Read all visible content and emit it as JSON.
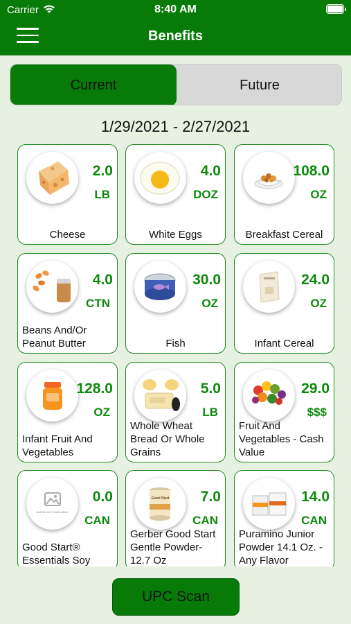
{
  "status_bar": {
    "carrier": "Carrier",
    "time": "8:40 AM"
  },
  "header": {
    "title": "Benefits"
  },
  "tabs": {
    "current": "Current",
    "future": "Future"
  },
  "date_range": "1/29/2021 - 2/27/2021",
  "benefits": [
    {
      "name": "Cheese",
      "qty": "2.0",
      "unit": "LB",
      "icon": "cheese-icon"
    },
    {
      "name": "White Eggs",
      "qty": "4.0",
      "unit": "DOZ",
      "icon": "egg-icon"
    },
    {
      "name": "Breakfast Cereal",
      "qty": "108.0",
      "unit": "OZ",
      "icon": "cereal-icon"
    },
    {
      "name": "Beans And/Or Peanut Butter",
      "qty": "4.0",
      "unit": "CTN",
      "icon": "beans-peanut-butter-icon"
    },
    {
      "name": "Fish",
      "qty": "30.0",
      "unit": "OZ",
      "icon": "fish-can-icon"
    },
    {
      "name": "Infant Cereal",
      "qty": "24.0",
      "unit": "OZ",
      "icon": "infant-cereal-icon"
    },
    {
      "name": "Infant Fruit And Vegetables",
      "qty": "128.0",
      "unit": "OZ",
      "icon": "baby-food-jar-icon"
    },
    {
      "name": "Whole Wheat Bread Or Whole Grains",
      "qty": "5.0",
      "unit": "LB",
      "icon": "bread-icon"
    },
    {
      "name": "Fruit And Vegetables - Cash Value",
      "qty": "29.0",
      "unit": "$$$",
      "icon": "produce-icon"
    },
    {
      "name": "Good Start® Essentials Soy",
      "qty": "0.0",
      "unit": "CAN",
      "icon": "image-not-available-icon",
      "placeholder_text": "IMAGE NOT AVAILABLE"
    },
    {
      "name": "Gerber Good Start Gentle Powder-12.7 Oz",
      "qty": "7.0",
      "unit": "CAN",
      "icon": "formula-can-icon",
      "can_label": "Good Start"
    },
    {
      "name": "Puramino Junior Powder 14.1 Oz. - Any Flavor",
      "qty": "14.0",
      "unit": "CAN",
      "icon": "formula-cans-icon"
    }
  ],
  "upc_button": "UPC Scan",
  "colors": {
    "primary": "#077a07",
    "accent_text": "#0c8a0c",
    "background": "#e6f1e2",
    "card_border": "#1e8a1e"
  }
}
